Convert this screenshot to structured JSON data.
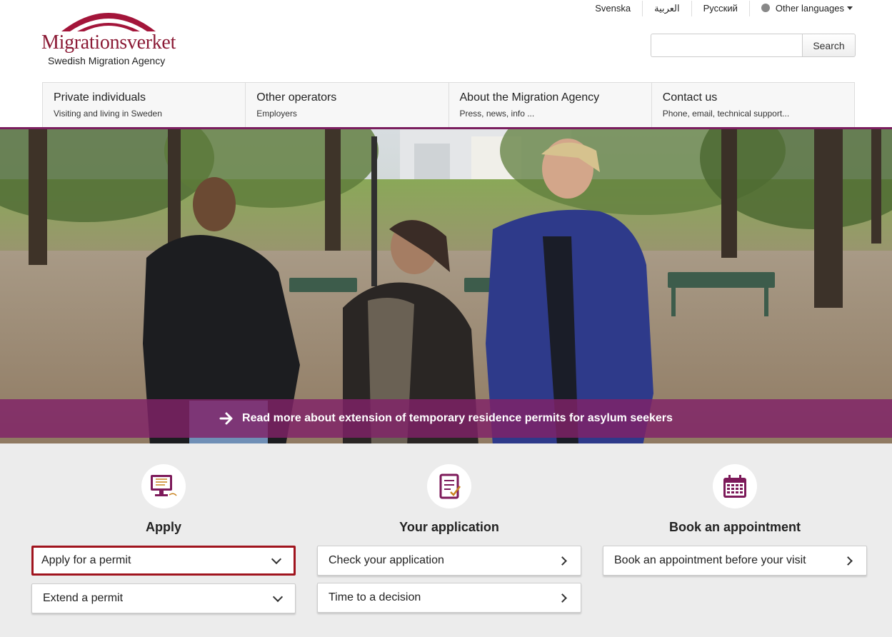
{
  "brand": {
    "name": "Migrationsverket",
    "subtitle": "Swedish Migration Agency",
    "color": "#8b1a35"
  },
  "languages": {
    "items": [
      "Svenska",
      "العربية",
      "Русский"
    ],
    "other": "Other languages"
  },
  "search": {
    "placeholder": "",
    "button": "Search"
  },
  "nav": [
    {
      "title": "Private individuals",
      "sub": "Visiting and living in Sweden"
    },
    {
      "title": "Other operators",
      "sub": "Employers"
    },
    {
      "title": "About the Migration Agency",
      "sub": "Press, news, info ..."
    },
    {
      "title": "Contact us",
      "sub": "Phone, email, technical support..."
    }
  ],
  "hero": {
    "banner_text": "Read more about extension of temporary residence permits for asylum seekers",
    "banner_color": "#802268"
  },
  "services": [
    {
      "icon": "computer-form-icon",
      "title": "Apply",
      "buttons": [
        {
          "label": "Apply for a permit",
          "chevron": "down",
          "highlighted": true
        },
        {
          "label": "Extend a permit",
          "chevron": "down",
          "highlighted": false
        }
      ]
    },
    {
      "icon": "document-check-icon",
      "title": "Your application",
      "buttons": [
        {
          "label": "Check your application",
          "chevron": "right"
        },
        {
          "label": "Time to a decision",
          "chevron": "right"
        }
      ]
    },
    {
      "icon": "calendar-icon",
      "title": "Book an appointment",
      "buttons": [
        {
          "label": "Book an appointment before your visit",
          "chevron": "right"
        }
      ]
    }
  ]
}
